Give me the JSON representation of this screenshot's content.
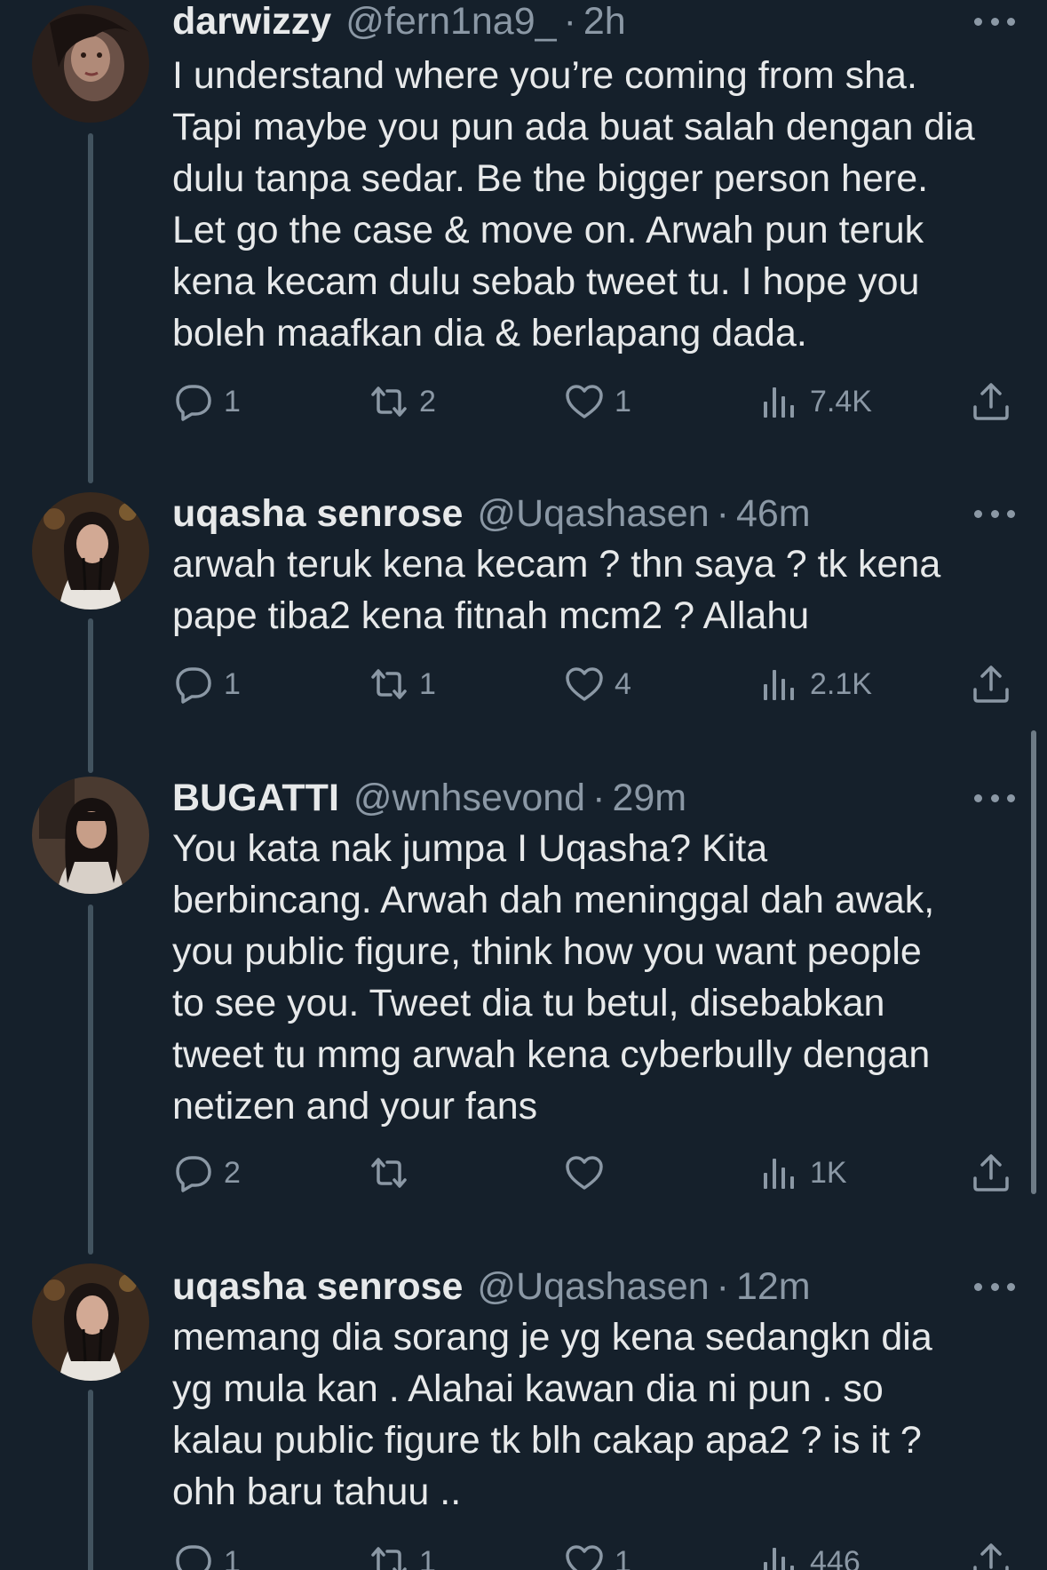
{
  "colors": {
    "background": "#15202b",
    "text": "#e7e9ea",
    "muted": "#8b98a5",
    "thread_line": "#42535f"
  },
  "icons": {
    "reply": "reply-icon",
    "retweet": "retweet-icon",
    "like": "heart-icon",
    "views": "views-icon",
    "share": "share-icon",
    "more": "more-icon"
  },
  "tweets": [
    {
      "name": "darwizzy",
      "handle": "@fern1na9_",
      "separator": "·",
      "time": "2h",
      "lines": [
        "I understand where you’re coming from sha.",
        "Tapi maybe you pun ada buat salah dengan dia",
        "dulu tanpa sedar. Be the bigger person here.",
        "Let go the case & move on. Arwah pun teruk",
        "kena kecam dulu sebab tweet tu. I hope you",
        "boleh maafkan dia & berlapang dada."
      ],
      "replies": "1",
      "retweets": "2",
      "likes": "1",
      "views": "7.4K"
    },
    {
      "name": "uqasha senrose",
      "handle": "@Uqashasen",
      "separator": "·",
      "time": "46m",
      "lines": [
        "arwah teruk kena kecam ? thn saya ? tk kena",
        "pape tiba2 kena fitnah mcm2 ? Allahu"
      ],
      "replies": "1",
      "retweets": "1",
      "likes": "4",
      "views": "2.1K"
    },
    {
      "name": "BUGATTI",
      "handle": "@wnhsevond",
      "separator": "·",
      "time": "29m",
      "lines": [
        "You kata nak jumpa I Uqasha? Kita",
        "berbincang. Arwah dah meninggal dah awak,",
        "you public figure, think how you want people",
        "to see you. Tweet dia tu betul, disebabkan",
        "tweet tu mmg arwah kena cyberbully dengan",
        "netizen and your fans"
      ],
      "replies": "2",
      "retweets": "",
      "likes": "",
      "views": "1K"
    },
    {
      "name": "uqasha senrose",
      "handle": "@Uqashasen",
      "separator": "·",
      "time": "12m",
      "lines": [
        "memang dia sorang je yg kena sedangkn dia",
        "yg mula kan . Alahai kawan dia ni pun . so",
        "kalau public figure tk blh cakap apa2 ? is it ?",
        "ohh baru tahuu .."
      ],
      "replies": "1",
      "retweets": "1",
      "likes": "1",
      "views": "446"
    }
  ]
}
